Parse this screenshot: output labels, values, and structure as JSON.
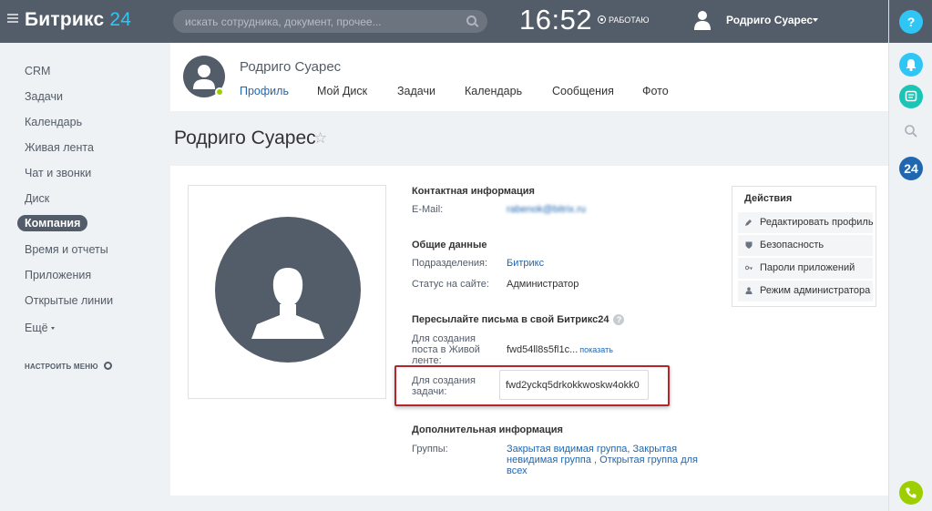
{
  "topbar": {
    "logo_text": "Битрикс",
    "logo_num": "24",
    "search_placeholder": "искать сотрудника, документ, прочее...",
    "clock": "16:52",
    "work_status": "РАБОТАЮ",
    "user_name": "Родриго Суарес"
  },
  "rightbar": {
    "help": "?",
    "b24": "24"
  },
  "leftmenu": {
    "items": [
      "CRM",
      "Задачи",
      "Календарь",
      "Живая лента",
      "Чат и звонки",
      "Диск",
      "Компания",
      "Время и отчеты",
      "Приложения",
      "Открытые линии",
      "Ещё"
    ],
    "active": "Компания",
    "configure": "НАСТРОИТЬ МЕНЮ"
  },
  "profile_header": {
    "name": "Родриго Суарес",
    "tabs": [
      "Профиль",
      "Мой Диск",
      "Задачи",
      "Календарь",
      "Сообщения",
      "Фото"
    ],
    "active_tab": "Профиль"
  },
  "page": {
    "title": "Родриго Суарес",
    "star": "☆"
  },
  "contact": {
    "title": "Контактная информация",
    "email_label": "E-Mail:",
    "email_value": "rabenok@bitrix.ru"
  },
  "general": {
    "title": "Общие данные",
    "dept_label": "Подразделения:",
    "dept_value": "Битрикс",
    "status_label": "Статус на сайте:",
    "status_value": "Администратор"
  },
  "forward": {
    "title": "Пересылайте письма в свой Битрикс24",
    "help": "?",
    "post_label": "Для создания поста в Живой ленте:",
    "post_value": "fwd54ll8s5fl1c...",
    "post_show": "показать",
    "task_label": "Для создания задачи:",
    "task_value": "fwd2yckq5drkokkwoskw4okk0"
  },
  "additional": {
    "title": "Дополнительная информация",
    "groups_label": "Группы:",
    "groups_value": "Закрытая видимая группа, Закрытая невидимая группа , Открытая группа для всех"
  },
  "actions": {
    "title": "Действия",
    "items": [
      "Редактировать профиль",
      "Безопасность",
      "Пароли приложений",
      "Режим администратора"
    ]
  },
  "colors": {
    "topbar": "#535c69",
    "accent": "#2fc6f6",
    "link": "#2067b0",
    "highlight": "#b5252b",
    "online": "#9dcf00"
  }
}
